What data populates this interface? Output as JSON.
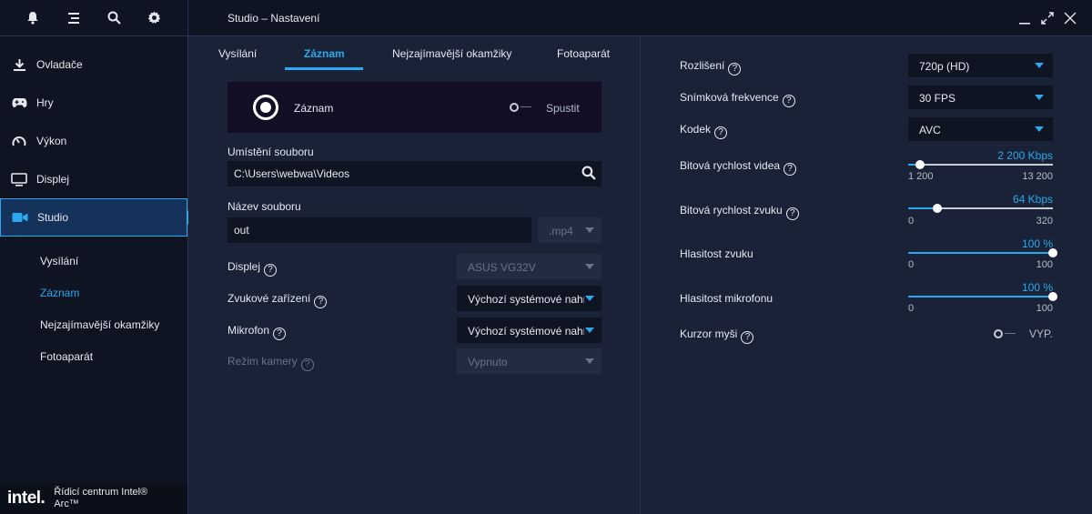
{
  "title": "Studio – Nastavení",
  "sidebar": {
    "items": [
      {
        "label": "Ovladače"
      },
      {
        "label": "Hry"
      },
      {
        "label": "Výkon"
      },
      {
        "label": "Displej"
      },
      {
        "label": "Studio"
      }
    ],
    "subitems": [
      {
        "label": "Vysílání"
      },
      {
        "label": "Záznam"
      },
      {
        "label": "Nejzajímavější okamžiky"
      },
      {
        "label": "Fotoaparát"
      }
    ],
    "brand": {
      "logo": "intel.",
      "line1": "Řídicí centrum Intel®",
      "line2": "Arc™"
    }
  },
  "tabs": [
    {
      "label": "Vysílání"
    },
    {
      "label": "Záznam"
    },
    {
      "label": "Nejzajímavější okamžiky"
    },
    {
      "label": "Fotoaparát"
    }
  ],
  "record": {
    "label": "Záznam",
    "toggle_label": "Spustit",
    "toggle_on": false
  },
  "file": {
    "location_label": "Umístění souboru",
    "location_value": "C:\\Users\\webwa\\Videos",
    "name_label": "Název souboru",
    "name_value": "out",
    "ext": ".mp4"
  },
  "settings": {
    "display": {
      "label": "Displej",
      "value": "ASUS VG32V"
    },
    "audio_device": {
      "label": "Zvukové zařízení",
      "value": "Výchozí systémové nahrávací zařízení"
    },
    "microphone": {
      "label": "Mikrofon",
      "value": "Výchozí systémové nahrávací zařízení"
    },
    "camera_mode": {
      "label": "Režim kamery",
      "value": "Vypnuto"
    }
  },
  "right": {
    "resolution": {
      "label": "Rozlišení",
      "value": "720p (HD)"
    },
    "framerate": {
      "label": "Snímková frekvence",
      "value": "30 FPS"
    },
    "codec": {
      "label": "Kodek",
      "value": "AVC"
    },
    "video_bitrate": {
      "label": "Bitová rychlost videa",
      "value_text": "2 200 Kbps",
      "value": 2200,
      "min": "1 200",
      "max": "13 200",
      "min_n": 1200,
      "max_n": 13200
    },
    "audio_bitrate": {
      "label": "Bitová rychlost zvuku",
      "value_text": "64 Kbps",
      "value": 64,
      "min": "0",
      "max": "320",
      "min_n": 0,
      "max_n": 320
    },
    "audio_volume": {
      "label": "Hlasitost zvuku",
      "value_text": "100 %",
      "value": 100,
      "min": "0",
      "max": "100",
      "min_n": 0,
      "max_n": 100
    },
    "mic_volume": {
      "label": "Hlasitost mikrofonu",
      "value_text": "100 %",
      "value": 100,
      "min": "0",
      "max": "100",
      "min_n": 0,
      "max_n": 100
    },
    "cursor": {
      "label": "Kurzor myši",
      "toggle_label": "VYP.",
      "toggle_on": false
    }
  },
  "colors": {
    "accent": "#2aa9ee",
    "bg": "#1a2238",
    "sidebar": "#0f1422"
  }
}
